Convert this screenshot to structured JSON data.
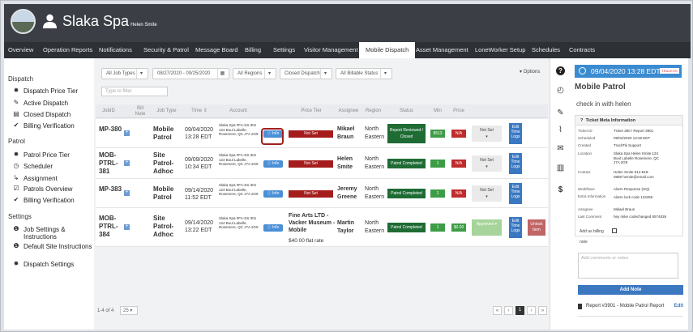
{
  "header": {
    "title": "Slaka Spa",
    "subtitle": "Helen Smite"
  },
  "nav": {
    "items": [
      "Overview",
      "Operation Reports",
      "Notifications",
      "Security & Patrol",
      "Message Board",
      "Billing",
      "Settings",
      "Visitor Management",
      "Mobile Dispatch",
      "Asset Management",
      "LoneWorker Setup",
      "Schedules",
      "Contracts"
    ],
    "active": "Mobile Dispatch"
  },
  "sidebar": {
    "dispatch_title": "Dispatch",
    "dispatch_items": [
      "Dispatch Price Tier",
      "Active Dispatch",
      "Closed Dispatch",
      "Billing Verification"
    ],
    "patrol_title": "Patrol",
    "patrol_items": [
      "Patrol Price Tier",
      "Scheduler",
      "Assignment",
      "Patrols Overview",
      "Billing Verification"
    ],
    "settings_title": "Settings",
    "settings_items": [
      "Job Settings & Instructions",
      "Default Site Instructions",
      "Dispatch Settings"
    ]
  },
  "filters": {
    "job_types": "All Job Types",
    "date_range": "08/27/2020 - 09/25/2020",
    "regions": "All Regions",
    "dispatch": "Closed Dispatch",
    "billable": "All Billable Status",
    "type_filter_placeholder": "Type to filter",
    "options": "▾ Options"
  },
  "table": {
    "headers": [
      "JobID",
      "Bill Note",
      "Job Type",
      "Time",
      "Account",
      "",
      "Price Tier",
      "Assignee",
      "Region",
      "Status",
      "Min",
      "Price",
      "",
      "",
      ""
    ],
    "rows": [
      {
        "id": "MP-380",
        "type": "Mobile Patrol",
        "time": "09/04/2020 13:28 EDT",
        "account": "Slaka Spa #FA-SS-301 124 Boul Labelle, Rosemere, QC J7A 2G9",
        "info": "Info",
        "tier": "Not Set",
        "assignee": "Mikael Braun",
        "region": "North Eastern",
        "status": "Report Reviewed / Closed",
        "min": "8513",
        "price": "N/A",
        "action": "Not Set",
        "edit": "Edit Time Logs"
      },
      {
        "id": "MOB-PTRL-381",
        "type": "Site Patrol-Adhoc",
        "time": "09/09/2020 10:34 EDT",
        "account": "Slaka Spa #FA-SS-301 124 Boul Labelle, Rosemere, QC J7A 2G9",
        "info": "Info",
        "tier": "Not Set",
        "assignee": "Helen Smite",
        "region": "North Eastern",
        "status": "Patrol Completed",
        "min": "1",
        "price": "N/A",
        "action": "Not Set",
        "edit": "Edit Time Logs"
      },
      {
        "id": "MP-383",
        "type": "Mobile Patrol",
        "time": "09/14/2020 11:52 EDT",
        "account": "Slaka Spa #FA-SS-301 124 Boul Labelle, Rosemere, QC J7A 2G9",
        "info": "Info",
        "tier": "Not Set",
        "assignee": "Jeremy Greene",
        "region": "North Eastern",
        "status": "Patrol Completed",
        "min": "1",
        "price": "N/A",
        "action": "Not Set",
        "edit": "Edit Time Logs"
      },
      {
        "id": "MOB-PTRL-384",
        "type": "Site Patrol-Adhoc",
        "time": "09/14/2020 13:22 EDT",
        "account": "Slaka Spa #FA-SS-301 124 Boul Labelle, Rosemere, QC J7A 2G9",
        "info": "Info",
        "tier_text": "Fine Arts LTD - Vacker Museum - Mobile",
        "tier_rate": "$40.00 flat rate",
        "assignee": "Martin Taylor",
        "region": "North Eastern",
        "status": "Patrol Completed",
        "min": "1",
        "price": "$0.00",
        "action": "Approved",
        "edit": "Edit Time Logs",
        "unlock": "Unlock Item"
      }
    ]
  },
  "footer": {
    "range": "1-4 of 4",
    "page_size": "25",
    "page": "1"
  },
  "right": {
    "header": "09/04/2020 13:28 EDT",
    "logo": "TRACKTIK",
    "title": "Mobile Patrol",
    "note": "check in with helen",
    "meta_title": "Ticket Meta Information",
    "meta": [
      {
        "label": "Ticket ID",
        "value": "Ticket 380 / Report 3901"
      },
      {
        "label": "Scheduled",
        "value": "09/04/2020 13:28 EDT"
      },
      {
        "label": "Created",
        "value": "TrackTik Support"
      },
      {
        "label": "Location",
        "value": "Slaka Spa Helen Smite 124 Boul Labelle Rosemere, QC J7A 2G9"
      },
      {
        "label": "Contact",
        "value": "Helen Smite 514-919-0888 hsmite@email.com"
      },
      {
        "label": "Workflows",
        "value": "Alarm Response (HQ)"
      },
      {
        "label": "Extra Information",
        "value": "Alarm lock code 123456"
      },
      {
        "label": "Assignee",
        "value": "Mikael Braun"
      },
      {
        "label": "Last Comment",
        "value": "hey mike codechanged 8574839"
      }
    ],
    "billing_label": "Add as billing",
    "billing_note": "note",
    "comments_placeholder": "Add comments or notes",
    "add_note": "Add Note",
    "report": "Report #3901 - Mobile Patrol Report",
    "report_edit": "Edit"
  }
}
